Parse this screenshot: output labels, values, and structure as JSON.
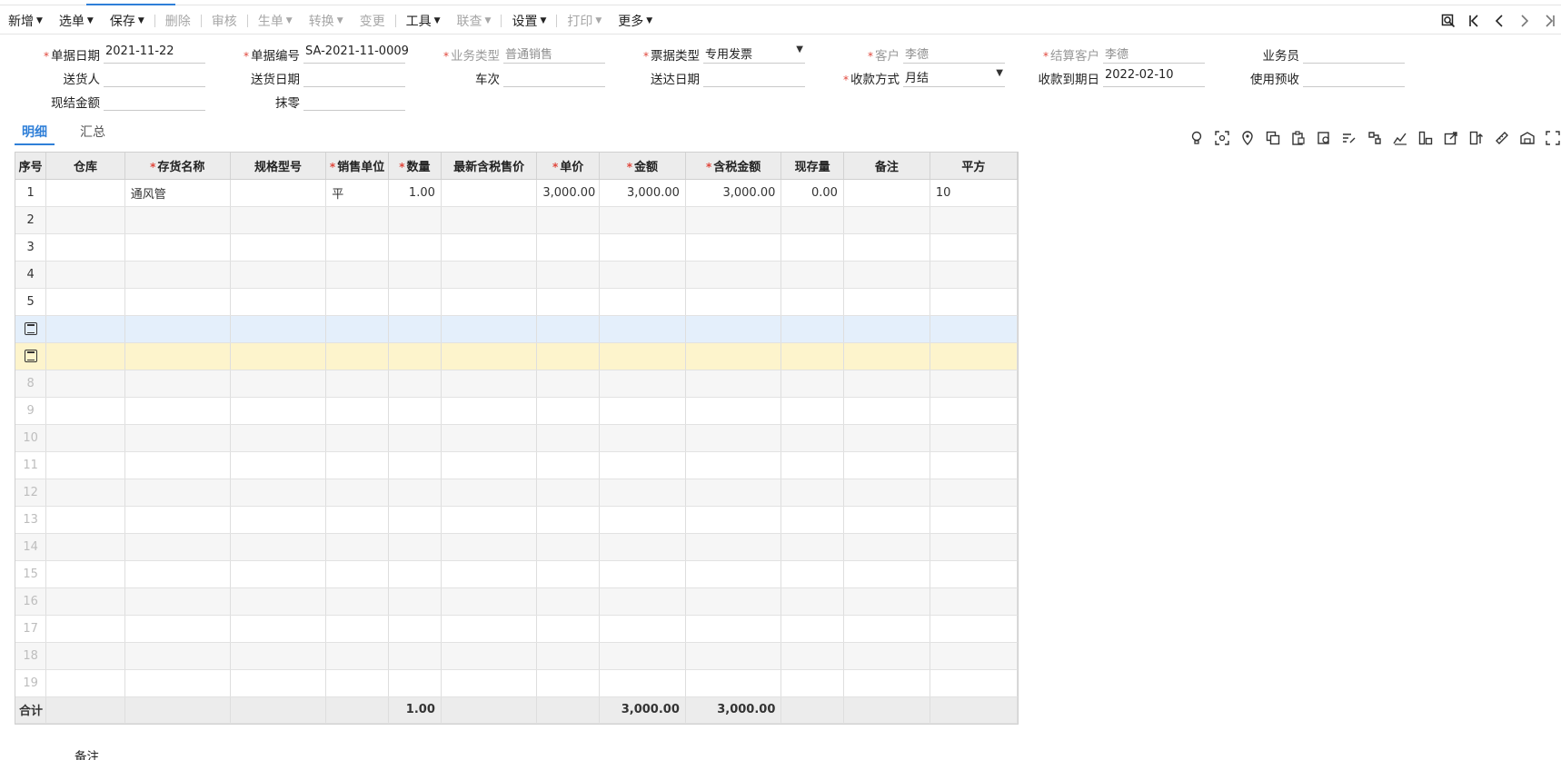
{
  "toolbar": {
    "items": [
      {
        "label": "新增",
        "caret": true,
        "disabled": false
      },
      {
        "label": "选单",
        "caret": true,
        "disabled": false
      },
      {
        "label": "保存",
        "caret": true,
        "disabled": false
      },
      {
        "label": "删除",
        "caret": false,
        "disabled": true
      },
      {
        "label": "审核",
        "caret": false,
        "disabled": true
      },
      {
        "label": "生单",
        "caret": true,
        "disabled": true
      },
      {
        "label": "转换",
        "caret": true,
        "disabled": true
      },
      {
        "label": "变更",
        "caret": false,
        "disabled": true
      },
      {
        "label": "工具",
        "caret": true,
        "disabled": false
      },
      {
        "label": "联查",
        "caret": true,
        "disabled": true
      },
      {
        "label": "设置",
        "caret": true,
        "disabled": false
      },
      {
        "label": "打印",
        "caret": true,
        "disabled": true
      },
      {
        "label": "更多",
        "caret": true,
        "disabled": false
      }
    ]
  },
  "form": {
    "doc_date": {
      "label": "单据日期",
      "value": "2021-11-22"
    },
    "doc_no": {
      "label": "单据编号",
      "value": "SA-2021-11-0009"
    },
    "biz_type": {
      "label": "业务类型",
      "value": "普通销售"
    },
    "invoice_type": {
      "label": "票据类型",
      "value": "专用发票"
    },
    "customer": {
      "label": "客户",
      "value": "李德"
    },
    "settle_customer": {
      "label": "结算客户",
      "value": "李德"
    },
    "salesman": {
      "label": "业务员",
      "value": ""
    },
    "deliverer": {
      "label": "送货人",
      "value": ""
    },
    "delivery_date": {
      "label": "送货日期",
      "value": ""
    },
    "vehicle": {
      "label": "车次",
      "value": ""
    },
    "arrival_date": {
      "label": "送达日期",
      "value": ""
    },
    "payment_method": {
      "label": "收款方式",
      "value": "月结"
    },
    "due_date": {
      "label": "收款到期日",
      "value": "2022-02-10"
    },
    "use_prepay": {
      "label": "使用预收",
      "value": ""
    },
    "cash_amount": {
      "label": "现结金额",
      "value": ""
    },
    "round_off": {
      "label": "抹零",
      "value": ""
    }
  },
  "tabs": [
    {
      "label": "明细",
      "active": true
    },
    {
      "label": "汇总",
      "active": false
    }
  ],
  "grid": {
    "columns": [
      {
        "label": "序号",
        "required": false
      },
      {
        "label": "仓库",
        "required": false
      },
      {
        "label": "存货名称",
        "required": true
      },
      {
        "label": "规格型号",
        "required": false
      },
      {
        "label": "销售单位",
        "required": true
      },
      {
        "label": "数量",
        "required": true
      },
      {
        "label": "最新含税售价",
        "required": false
      },
      {
        "label": "单价",
        "required": true
      },
      {
        "label": "金额",
        "required": true
      },
      {
        "label": "含税金额",
        "required": true
      },
      {
        "label": "现存量",
        "required": false
      },
      {
        "label": "备注",
        "required": false
      },
      {
        "label": "平方",
        "required": false
      }
    ],
    "rows": [
      {
        "seq": "1",
        "cells": [
          "",
          "通风管",
          "",
          "平",
          "1.00",
          "",
          "3,000.00",
          "3,000.00",
          "3,000.00",
          "0.00",
          "",
          "10"
        ]
      },
      {
        "seq": "2",
        "cells": [
          "",
          "",
          "",
          "",
          "",
          "",
          "",
          "",
          "",
          "",
          "",
          ""
        ]
      },
      {
        "seq": "3",
        "cells": [
          "",
          "",
          "",
          "",
          "",
          "",
          "",
          "",
          "",
          "",
          "",
          ""
        ]
      },
      {
        "seq": "4",
        "cells": [
          "",
          "",
          "",
          "",
          "",
          "",
          "",
          "",
          "",
          "",
          "",
          ""
        ]
      },
      {
        "seq": "5",
        "cells": [
          "",
          "",
          "",
          "",
          "",
          "",
          "",
          "",
          "",
          "",
          "",
          ""
        ]
      },
      {
        "seq": "",
        "cells": [
          "",
          "",
          "",
          "",
          "",
          "",
          "",
          "",
          "",
          "",
          "",
          ""
        ]
      },
      {
        "seq": "",
        "cells": [
          "",
          "",
          "",
          "",
          "",
          "",
          "",
          "",
          "",
          "",
          "",
          ""
        ]
      },
      {
        "seq": "8",
        "cells": [
          "",
          "",
          "",
          "",
          "",
          "",
          "",
          "",
          "",
          "",
          "",
          ""
        ]
      },
      {
        "seq": "9",
        "cells": [
          "",
          "",
          "",
          "",
          "",
          "",
          "",
          "",
          "",
          "",
          "",
          ""
        ]
      },
      {
        "seq": "10",
        "cells": [
          "",
          "",
          "",
          "",
          "",
          "",
          "",
          "",
          "",
          "",
          "",
          ""
        ]
      },
      {
        "seq": "11",
        "cells": [
          "",
          "",
          "",
          "",
          "",
          "",
          "",
          "",
          "",
          "",
          "",
          ""
        ]
      },
      {
        "seq": "12",
        "cells": [
          "",
          "",
          "",
          "",
          "",
          "",
          "",
          "",
          "",
          "",
          "",
          ""
        ]
      },
      {
        "seq": "13",
        "cells": [
          "",
          "",
          "",
          "",
          "",
          "",
          "",
          "",
          "",
          "",
          "",
          ""
        ]
      },
      {
        "seq": "14",
        "cells": [
          "",
          "",
          "",
          "",
          "",
          "",
          "",
          "",
          "",
          "",
          "",
          ""
        ]
      },
      {
        "seq": "15",
        "cells": [
          "",
          "",
          "",
          "",
          "",
          "",
          "",
          "",
          "",
          "",
          "",
          ""
        ]
      },
      {
        "seq": "16",
        "cells": [
          "",
          "",
          "",
          "",
          "",
          "",
          "",
          "",
          "",
          "",
          "",
          ""
        ]
      },
      {
        "seq": "17",
        "cells": [
          "",
          "",
          "",
          "",
          "",
          "",
          "",
          "",
          "",
          "",
          "",
          ""
        ]
      },
      {
        "seq": "18",
        "cells": [
          "",
          "",
          "",
          "",
          "",
          "",
          "",
          "",
          "",
          "",
          "",
          ""
        ]
      },
      {
        "seq": "19",
        "cells": [
          "",
          "",
          "",
          "",
          "",
          "",
          "",
          "",
          "",
          "",
          "",
          ""
        ]
      }
    ],
    "total": {
      "label": "合计",
      "qty": "1.00",
      "amount": "3,000.00",
      "tax_amount": "3,000.00"
    }
  },
  "remark": {
    "label": "备注"
  },
  "colors": {
    "accent": "#2f7fd8",
    "required": "#e0463b"
  }
}
